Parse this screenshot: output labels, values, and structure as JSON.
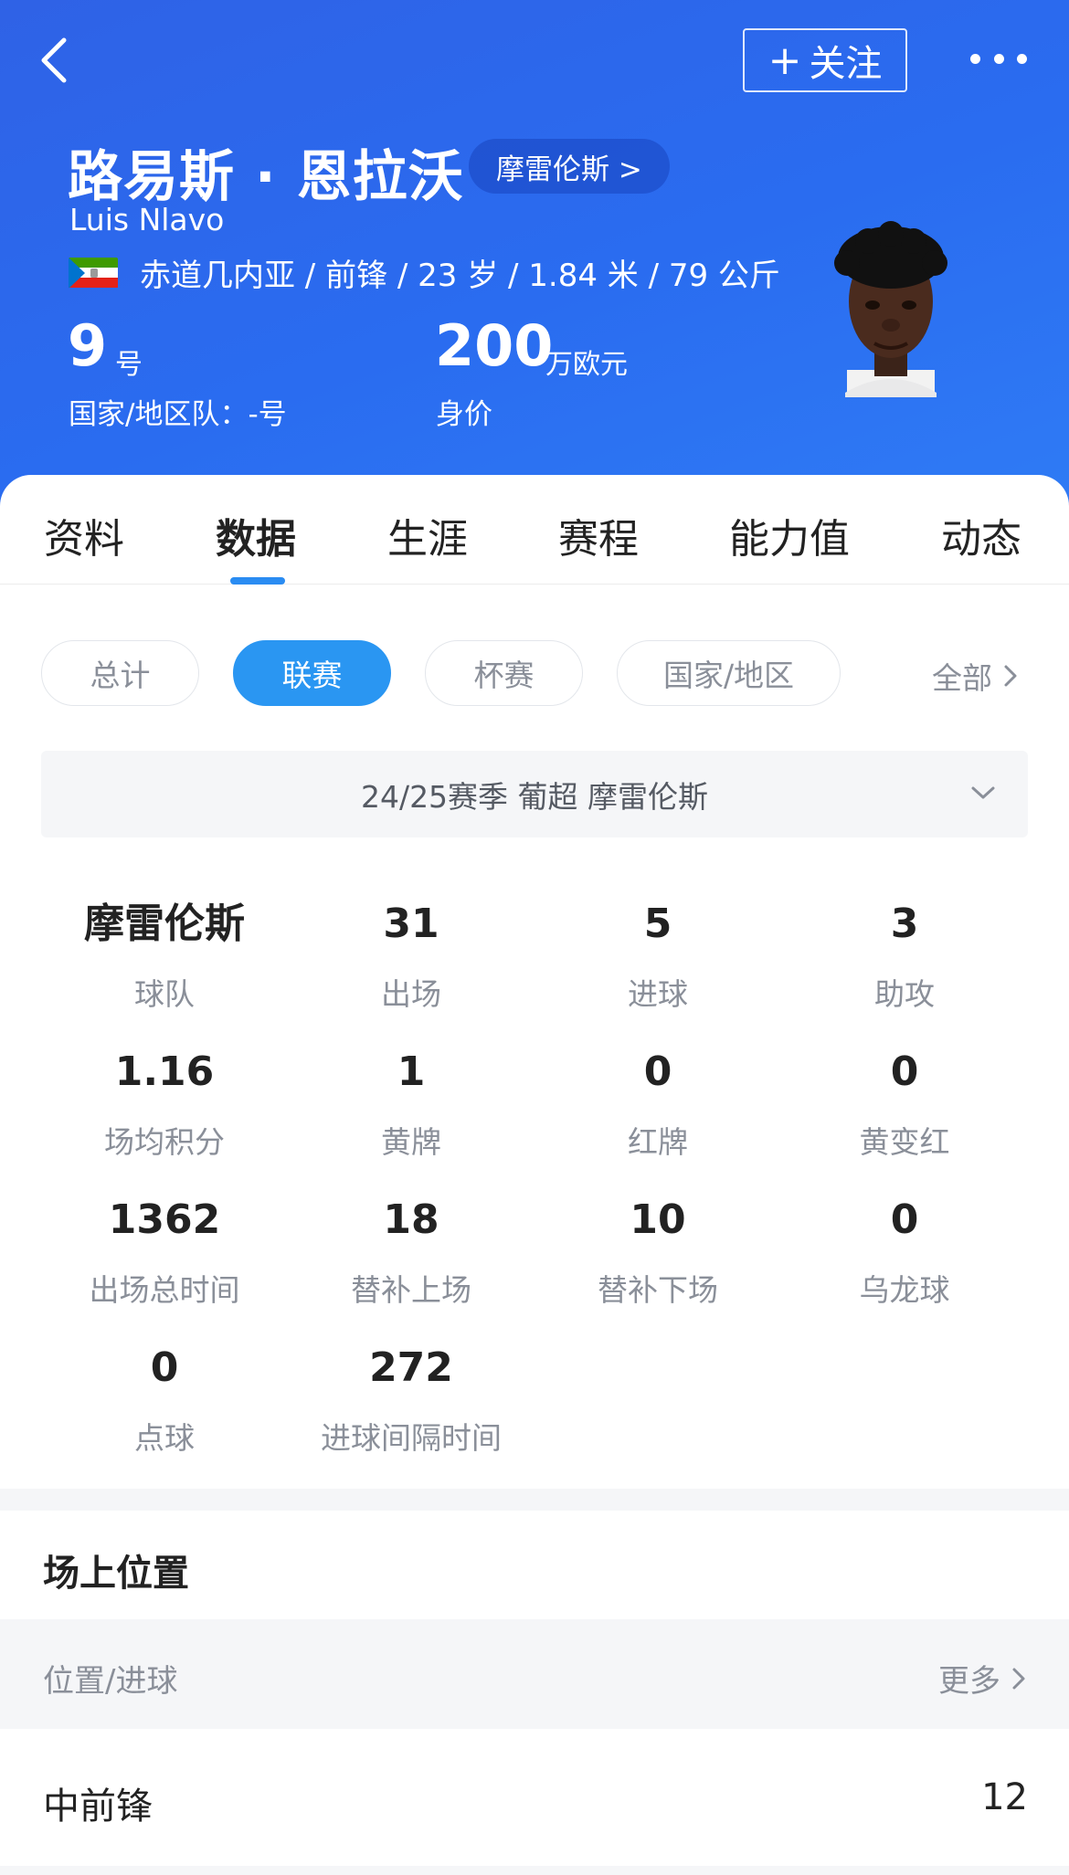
{
  "header": {
    "follow_label": "关注",
    "player_name_cn": "路易斯 · 恩拉沃",
    "team_pill": "摩雷伦斯 >",
    "player_name_en": "Luis Nlavo",
    "info_line": "赤道几内亚 / 前锋 / 23 岁 / 1.84 米 / 79 公斤",
    "shirt_number": "9",
    "shirt_unit": "号",
    "national_team": "国家/地区队：-号",
    "market_value": "200",
    "market_value_unit": "万欧元",
    "market_value_label": "身价",
    "colors": {
      "gradient_start": "#2f62e6",
      "gradient_end": "#2f7bf5"
    }
  },
  "tabs": [
    {
      "label": "资料"
    },
    {
      "label": "数据",
      "active": true
    },
    {
      "label": "生涯"
    },
    {
      "label": "赛程"
    },
    {
      "label": "能力值"
    },
    {
      "label": "动态"
    }
  ],
  "filters": {
    "chips": [
      {
        "label": "总计"
      },
      {
        "label": "联赛",
        "active": true
      },
      {
        "label": "杯赛"
      },
      {
        "label": "国家/地区"
      }
    ],
    "all_label": "全部"
  },
  "season_select": "24/25赛季 葡超 摩雷伦斯",
  "stats": [
    {
      "value": "摩雷伦斯",
      "label": "球队"
    },
    {
      "value": "31",
      "label": "出场"
    },
    {
      "value": "5",
      "label": "进球"
    },
    {
      "value": "3",
      "label": "助攻"
    },
    {
      "value": "1.16",
      "label": "场均积分"
    },
    {
      "value": "1",
      "label": "黄牌"
    },
    {
      "value": "0",
      "label": "红牌"
    },
    {
      "value": "0",
      "label": "黄变红"
    },
    {
      "value": "1362",
      "label": "出场总时间"
    },
    {
      "value": "18",
      "label": "替补上场"
    },
    {
      "value": "10",
      "label": "替补下场"
    },
    {
      "value": "0",
      "label": "乌龙球"
    },
    {
      "value": "0",
      "label": "点球"
    },
    {
      "value": "272",
      "label": "进球间隔时间"
    }
  ],
  "position_section": {
    "title": "场上位置",
    "header_left": "位置/进球",
    "header_right": "更多",
    "rows": [
      {
        "position": "中前锋",
        "goals": "12"
      }
    ]
  },
  "icons": {
    "back": "chevron-left-icon",
    "more": "more-dots-icon",
    "flag": "equatorial-guinea-flag-icon",
    "dropdown": "chevron-down-icon",
    "all_arrow": "chevron-right-icon"
  },
  "accent_color": "#2a96f2"
}
